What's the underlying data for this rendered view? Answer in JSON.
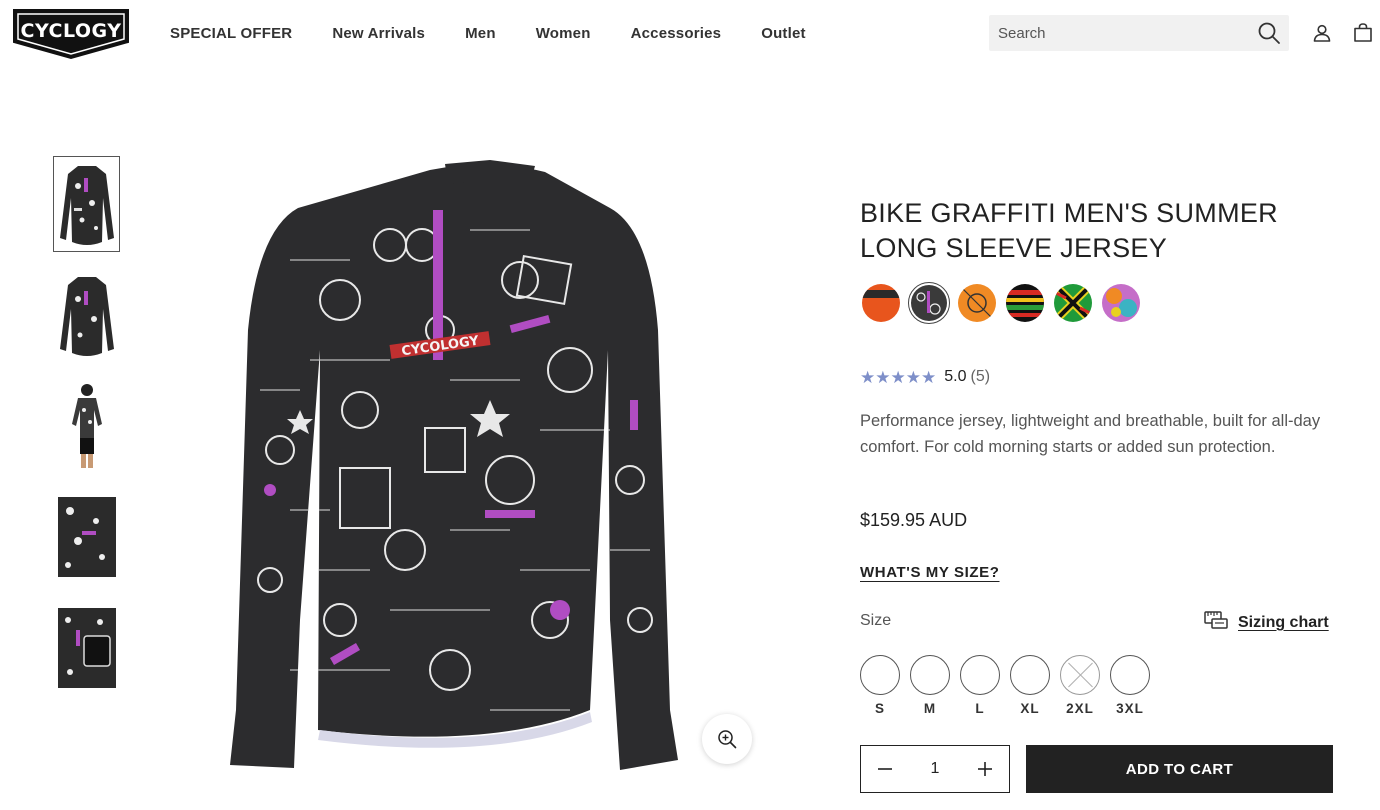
{
  "brand": {
    "logo_text": "CYCLOGY"
  },
  "nav": {
    "items": [
      {
        "label": "SPECIAL OFFER"
      },
      {
        "label": "New Arrivals"
      },
      {
        "label": "Men"
      },
      {
        "label": "Women"
      },
      {
        "label": "Accessories"
      },
      {
        "label": "Outlet"
      }
    ]
  },
  "search": {
    "placeholder": "Search",
    "icon": "search-icon"
  },
  "header_icons": [
    "account-icon",
    "cart-icon"
  ],
  "gallery": {
    "thumbnails": [
      "jersey-front",
      "jersey-front-2",
      "rider-wearing-jersey",
      "jersey-detail",
      "jersey-back-pocket"
    ],
    "active_thumbnail": 0,
    "zoom_icon": "zoom-in-icon",
    "jersey_print_text": "CYCOLOGY"
  },
  "product": {
    "title": "BIKE GRAFFITI MEN'S SUMMER LONG SLEEVE JERSEY",
    "swatches": [
      {
        "name": "orange-black",
        "color": "#e8551d"
      },
      {
        "name": "bike-graffiti",
        "color": "#3a3a3a",
        "selected": true
      },
      {
        "name": "orange-pattern",
        "color": "#f08a24"
      },
      {
        "name": "stripes",
        "color": "#d82a23"
      },
      {
        "name": "zebra-flag",
        "color": "#e8d21f"
      },
      {
        "name": "tie-dye",
        "color": "#c56ec8"
      }
    ],
    "rating": {
      "stars": 5,
      "value": "5.0",
      "count": "(5)",
      "star_color": "#7e8fc9"
    },
    "description": "Performance jersey, lightweight and breathable, built for all-day comfort. For cold morning starts or added sun protection.",
    "price": "$159.95 AUD",
    "whats_my_size": "WHAT'S MY SIZE?",
    "size_label": "Size",
    "sizing_chart": "Sizing chart",
    "sizes": [
      {
        "label": "S",
        "available": true
      },
      {
        "label": "M",
        "available": true
      },
      {
        "label": "L",
        "available": true
      },
      {
        "label": "XL",
        "available": true
      },
      {
        "label": "2XL",
        "available": false
      },
      {
        "label": "3XL",
        "available": true
      }
    ],
    "quantity": "1",
    "add_to_cart": "ADD TO CART"
  }
}
